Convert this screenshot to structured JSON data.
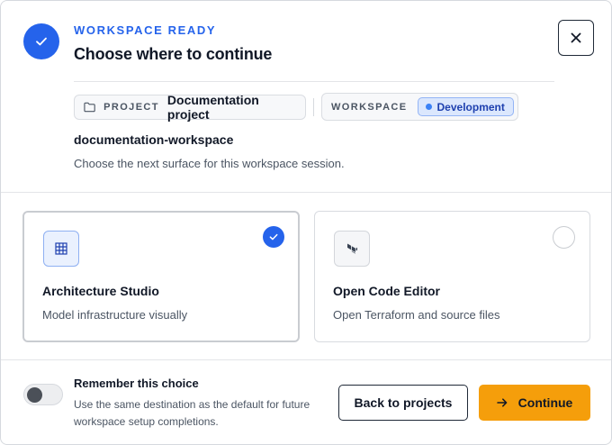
{
  "header": {
    "eyebrow": "WORKSPACE READY",
    "title": "Choose where to continue",
    "status_icon": "check-icon",
    "close_icon": "close-icon"
  },
  "context": {
    "project_label": "PROJECT",
    "project_name": "Documentation project",
    "project_icon": "folder-icon",
    "workspace_label": "WORKSPACE",
    "environment": "Development",
    "workspace_slug": "documentation-workspace",
    "subtitle": "Choose the next surface for this workspace session."
  },
  "options": [
    {
      "title": "Architecture Studio",
      "description": "Model infrastructure visually",
      "icon": "grid-icon",
      "selected": true
    },
    {
      "title": "Open Code Editor",
      "description": "Open Terraform and source files",
      "icon": "terraform-icon",
      "selected": false
    }
  ],
  "footer": {
    "remember_title": "Remember this choice",
    "remember_description": "Use the same destination as the default for future workspace setup completions.",
    "remember_enabled": false,
    "back_label": "Back to projects",
    "continue_label": "Continue",
    "continue_icon": "arrow-right-icon"
  },
  "colors": {
    "accent": "#2563eb",
    "primary_button": "#f59e0b",
    "environment_badge": "#dbe7fd"
  }
}
